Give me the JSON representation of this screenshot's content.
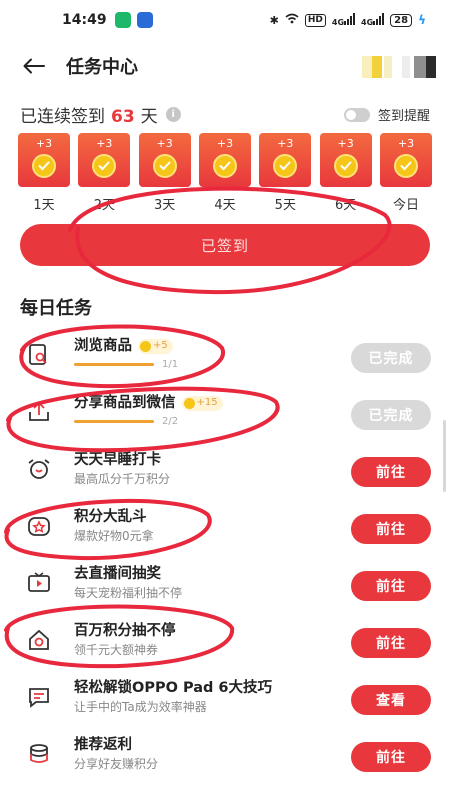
{
  "status_bar": {
    "time": "14:49",
    "signal_label": "HD",
    "network_labels": [
      "4G",
      "4G"
    ],
    "battery": "28",
    "notif_colors": [
      "#1fb868",
      "#2a6bd8"
    ]
  },
  "header": {
    "title": "任务中心"
  },
  "checkin": {
    "streak_prefix": "已连续签到",
    "streak_days": "63",
    "streak_suffix": "天",
    "reminder_label": "签到提醒",
    "days": [
      {
        "reward": "+3",
        "label": "1天"
      },
      {
        "reward": "+3",
        "label": "2天"
      },
      {
        "reward": "+3",
        "label": "3天"
      },
      {
        "reward": "+3",
        "label": "4天"
      },
      {
        "reward": "+3",
        "label": "5天"
      },
      {
        "reward": "+3",
        "label": "6天"
      },
      {
        "reward": "+3",
        "label": "今日"
      }
    ],
    "signed_button": "已签到"
  },
  "daily_tasks": {
    "title": "每日任务",
    "tasks": [
      {
        "icon": "search-doc-icon",
        "name": "浏览商品",
        "points": "+5",
        "progress": "1/1",
        "button": "已完成",
        "done": true
      },
      {
        "icon": "share-icon",
        "name": "分享商品到微信",
        "points": "+15",
        "progress": "2/2",
        "button": "已完成",
        "done": true
      },
      {
        "icon": "alarm-clock-icon",
        "name": "天天早睡打卡",
        "sub": "最高瓜分千万积分",
        "button": "前往",
        "done": false
      },
      {
        "icon": "star-badge-icon",
        "name": "积分大乱斗",
        "sub": "爆款好物0元拿",
        "button": "前往",
        "done": false
      },
      {
        "icon": "live-tv-icon",
        "name": "去直播间抽奖",
        "sub": "每天宠粉福利抽不停",
        "button": "前往",
        "done": false
      },
      {
        "icon": "home-star-icon",
        "name": "百万积分抽不停",
        "sub": "领千元大额神券",
        "button": "前往",
        "done": false
      },
      {
        "icon": "message-icon",
        "name": "轻松解锁OPPO Pad 6大技巧",
        "sub": "让手中的Ta成为效率神器",
        "button": "查看",
        "done": false
      },
      {
        "icon": "coin-stack-icon",
        "name": "推荐返利",
        "sub": "分享好友赚积分",
        "button": "前往",
        "done": false
      }
    ]
  },
  "colors": {
    "accent": "#e8383d",
    "done_button": "#d9d9d9",
    "progress": "#f0a030",
    "coin": "#f5c518"
  }
}
